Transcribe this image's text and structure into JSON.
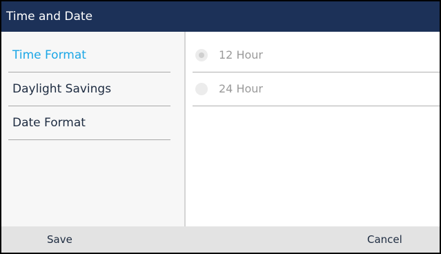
{
  "header": {
    "title": "Time and Date"
  },
  "sidebar": {
    "items": [
      {
        "label": "Time Format",
        "selected": true
      },
      {
        "label": "Daylight Savings",
        "selected": false
      },
      {
        "label": "Date Format",
        "selected": false
      }
    ]
  },
  "options": {
    "items": [
      {
        "label": "12 Hour",
        "selected": true
      },
      {
        "label": "24 Hour",
        "selected": false
      }
    ]
  },
  "softkeys": {
    "save_label": "Save",
    "cancel_label": "Cancel"
  },
  "colors": {
    "title_bar": "#1c3158",
    "selected_item": "#1aa6e6",
    "item_text": "#1d2b40",
    "option_text_disabled": "#9a9a9a",
    "softkey_bar": "#e3e3e3"
  }
}
